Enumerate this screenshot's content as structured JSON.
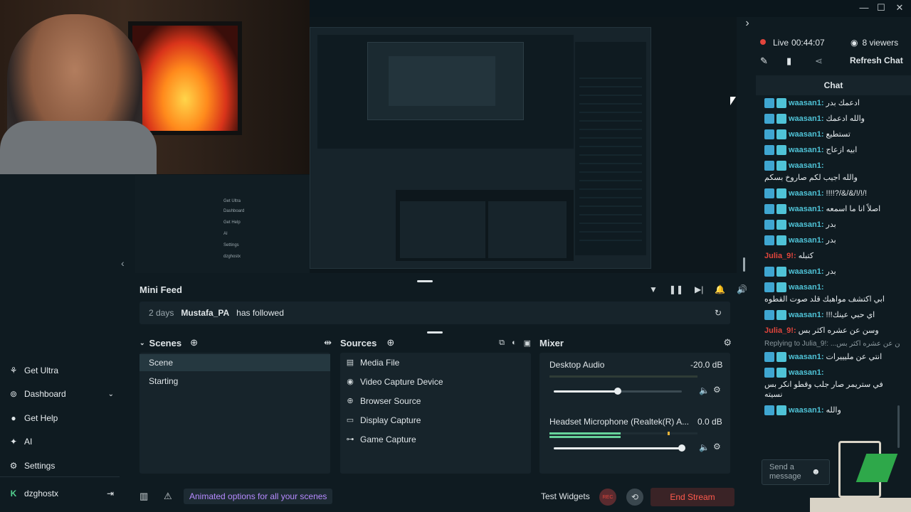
{
  "window": {
    "minimize": "—",
    "maximize": "☐",
    "close": "✕",
    "chevron": "›"
  },
  "status": {
    "live_label": "Live",
    "live_time": "00:44:07",
    "viewers": "8 viewers",
    "refresh_chat": "Refresh Chat",
    "chat_title": "Chat"
  },
  "preview": {
    "nested_items": [
      "Get Ultra",
      "Dashboard",
      "Get Help",
      "AI",
      "Settings",
      "dzghostx"
    ],
    "nested_sources": [
      "Media File",
      "Video Capture Device",
      "Browser Source",
      "Display Capture",
      "Game Capture"
    ],
    "nested_scenes": [
      "Scene",
      "Starting"
    ],
    "nested_headers": [
      "Scenes",
      "Sources",
      "Mixer"
    ],
    "nested_feed": "2 days   Mustafa_PA   has followed",
    "nested_mixer": [
      "Desktop Audio",
      "-20.0 dB",
      "Headset Microphone (Realtek(R) A...",
      "0.0 dB"
    ],
    "nested_bottom": [
      "Animated options for all your scenes",
      "Test Widgets",
      "End Stream"
    ]
  },
  "nav": {
    "items": [
      {
        "label": "Get Ultra",
        "icon": "ultra-icon"
      },
      {
        "label": "Dashboard",
        "icon": "dashboard-icon"
      },
      {
        "label": "Get Help",
        "icon": "help-icon"
      },
      {
        "label": "AI",
        "icon": "ai-icon"
      },
      {
        "label": "Settings",
        "icon": "gear-icon"
      }
    ],
    "user": "dzghostx"
  },
  "minifeed": {
    "title": "Mini Feed",
    "time": "2 days",
    "user": "Mustafa_PA",
    "action": "has followed"
  },
  "scenes": {
    "title": "Scenes",
    "items": [
      "Scene",
      "Starting"
    ]
  },
  "sources": {
    "title": "Sources",
    "items": [
      {
        "label": "Media File",
        "icon": "media-file-icon"
      },
      {
        "label": "Video Capture Device",
        "icon": "webcam-icon"
      },
      {
        "label": "Browser Source",
        "icon": "globe-icon"
      },
      {
        "label": "Display Capture",
        "icon": "monitor-icon"
      },
      {
        "label": "Game Capture",
        "icon": "gamepad-icon"
      }
    ]
  },
  "mixer": {
    "title": "Mixer",
    "channels": [
      {
        "name": "Desktop Audio",
        "db": "-20.0 dB",
        "volume": 0.5
      },
      {
        "name": "Headset Microphone (Realtek(R) A...",
        "db": "0.0 dB",
        "volume": 1.0
      }
    ]
  },
  "bottombar": {
    "promo": "Animated options for all your scenes",
    "test_widgets": "Test Widgets",
    "rec": "REC",
    "end_stream": "End Stream"
  },
  "chat": {
    "messages": [
      {
        "user": "waasan1:",
        "text": "ادعمك بدر",
        "color": "cyan"
      },
      {
        "user": "waasan1:",
        "text": "والله ادعمك",
        "color": "cyan"
      },
      {
        "user": "waasan1:",
        "text": "تستطيع",
        "color": "cyan"
      },
      {
        "user": "waasan1:",
        "text": "ابيه ازعاج",
        "color": "cyan"
      },
      {
        "user": "waasan1:",
        "text": "والله اجيب لكم صاروخ بسكم",
        "color": "cyan"
      },
      {
        "user": "waasan1:",
        "text": "!!!!?/&/&/!/!/!",
        "color": "cyan"
      },
      {
        "user": "waasan1:",
        "text": "اصلاً انا ما اسمعه",
        "color": "cyan"
      },
      {
        "user": "waasan1:",
        "text": "بدر",
        "color": "cyan"
      },
      {
        "user": "waasan1:",
        "text": "بدر",
        "color": "cyan"
      },
      {
        "user": "Julia_9!:",
        "text": "كتبله",
        "color": "red"
      },
      {
        "user": "waasan1:",
        "text": "بدر",
        "color": "cyan"
      },
      {
        "user": "waasan1:",
        "text": "ابي اكتشف مواهبك قلد صوت القطوه",
        "color": "cyan"
      },
      {
        "user": "waasan1:",
        "text": "!!!اي حبي عينك",
        "color": "cyan"
      },
      {
        "user": "Julia_9!:",
        "text": "وسن عن عشره اكثر بس",
        "color": "red"
      },
      {
        "user": "waasan1:",
        "text": "انتي عن مليييرات",
        "color": "cyan",
        "reply": "Replying to Julia_9!: ...وسن عن عشره اكثر بس"
      },
      {
        "user": "waasan1:",
        "text": "في ستريمر صار جلب وقطو انكر بس نسيته",
        "color": "cyan"
      },
      {
        "user": "waasan1:",
        "text": "والله",
        "color": "cyan"
      }
    ],
    "send_placeholder": "Send a message"
  }
}
